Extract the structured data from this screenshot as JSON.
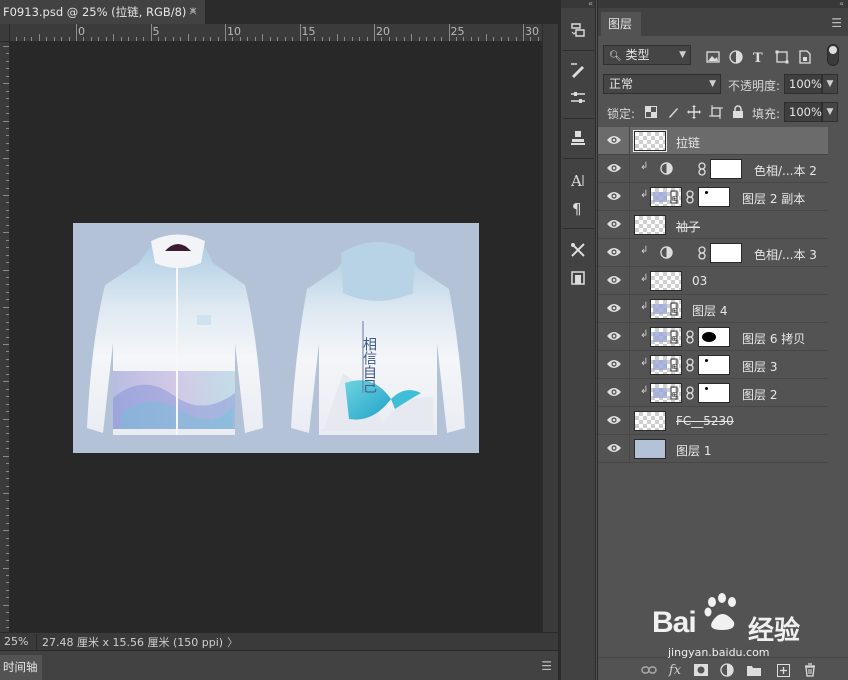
{
  "document": {
    "tab_title": "F0913.psd @ 25% (拉链, RGB/8) *",
    "close_glyph": "×",
    "ruler_top_numbers": [
      "0",
      "5",
      "10",
      "15",
      "20",
      "25",
      "30"
    ]
  },
  "status": {
    "zoom": "25%",
    "doc_info": "27.48 厘米 x 15.56 厘米 (150 ppi)",
    "more_glyph": "〉"
  },
  "timeline": {
    "tab_label": "时间轴"
  },
  "panel": {
    "collapse_glyph": "«",
    "tab_label": "图层",
    "filter": {
      "selected": "类型",
      "icons": [
        "image-filter-icon",
        "adjustment-filter-icon",
        "type-filter-icon",
        "shape-filter-icon",
        "smartobject-filter-icon"
      ]
    },
    "blend_mode": "正常",
    "opacity_label": "不透明度:",
    "opacity_value": "100%",
    "lock_label": "锁定:",
    "fill_label": "填充:",
    "fill_value": "100%"
  },
  "layers": [
    {
      "name": "拉链",
      "selected": true,
      "clipped": false,
      "adjustment": false,
      "has_mask": false,
      "strike": false
    },
    {
      "name": "色相/...本 2",
      "selected": false,
      "clipped": true,
      "adjustment": true,
      "has_mask": true,
      "strike": false
    },
    {
      "name": "图层 2 副本",
      "selected": false,
      "clipped": true,
      "adjustment": false,
      "has_mask": true,
      "strike": false
    },
    {
      "name": "袖子",
      "selected": false,
      "clipped": false,
      "adjustment": false,
      "has_mask": false,
      "strike": true
    },
    {
      "name": "色相/...本 3",
      "selected": false,
      "clipped": true,
      "adjustment": true,
      "has_mask": true,
      "strike": false
    },
    {
      "name": "03",
      "selected": false,
      "clipped": true,
      "adjustment": false,
      "has_mask": false,
      "strike": false
    },
    {
      "name": "图层 4",
      "selected": false,
      "clipped": true,
      "adjustment": false,
      "has_mask": false,
      "strike": false
    },
    {
      "name": "图层 6 拷贝",
      "selected": false,
      "clipped": true,
      "adjustment": false,
      "has_mask": true,
      "strike": false
    },
    {
      "name": "图层 3",
      "selected": false,
      "clipped": true,
      "adjustment": false,
      "has_mask": true,
      "strike": false
    },
    {
      "name": "图层 2",
      "selected": false,
      "clipped": true,
      "adjustment": false,
      "has_mask": true,
      "strike": false
    },
    {
      "name": "FC__5230",
      "selected": false,
      "clipped": false,
      "adjustment": false,
      "has_mask": false,
      "strike": true
    },
    {
      "name": "图层 1",
      "selected": false,
      "clipped": false,
      "adjustment": false,
      "has_mask": false,
      "strike": false
    }
  ],
  "footer": {
    "fx_label": "fx"
  },
  "artwork": {
    "title_text": "相信自己",
    "background_color": "#b3c2d6"
  },
  "watermark": {
    "brand": "Bai",
    "brand2": "经验",
    "url": "jingyan.baidu.com"
  },
  "colors": {
    "panel_bg": "#535353",
    "canvas_bg": "#282828",
    "selected_row": "#6b6b6b"
  }
}
